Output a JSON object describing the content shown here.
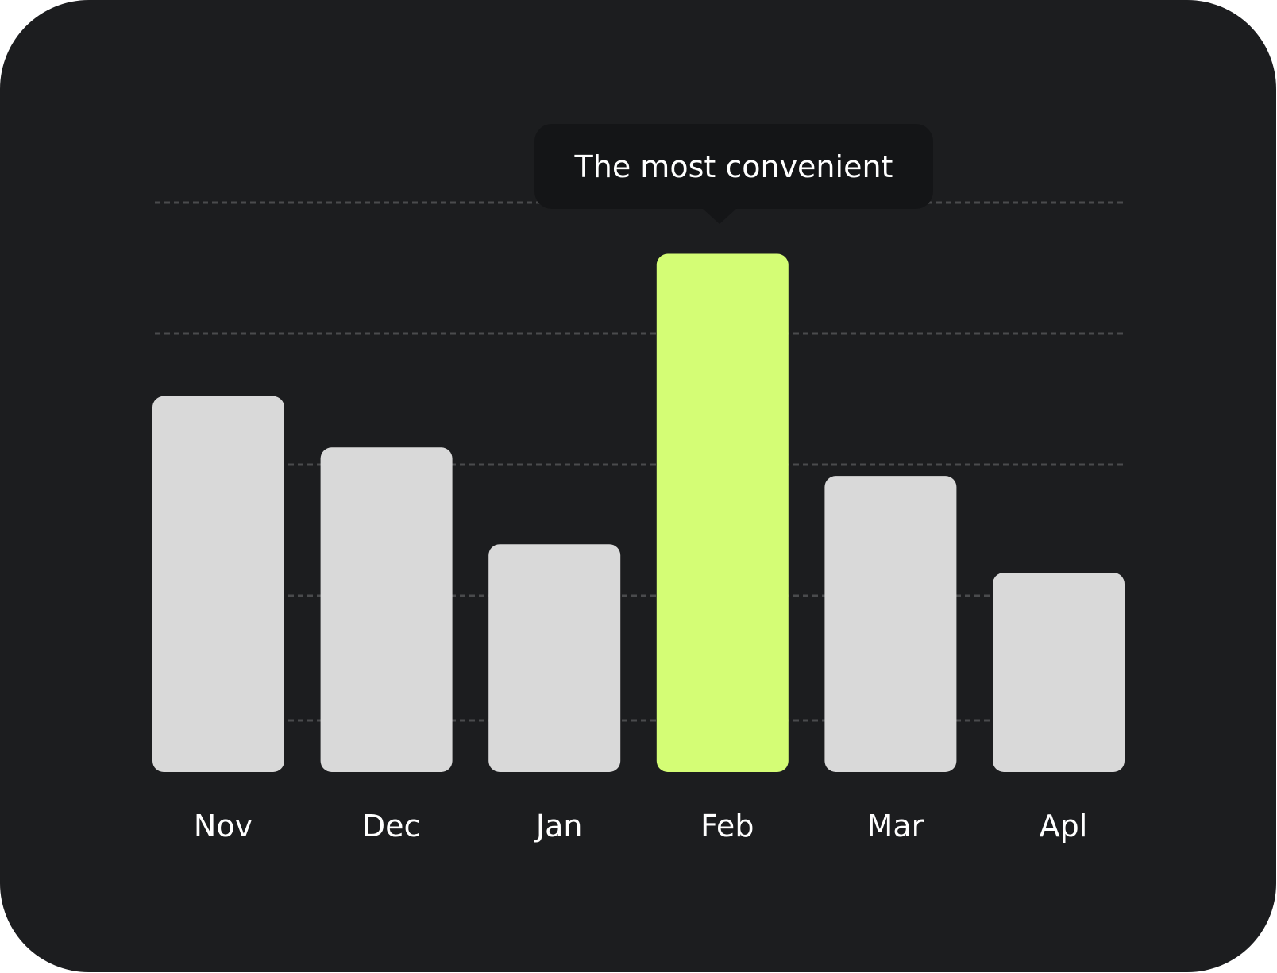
{
  "chart_data": {
    "type": "bar",
    "title": "",
    "xlabel": "",
    "ylabel": "",
    "categories": [
      "Nov",
      "Dec",
      "Jan",
      "Feb",
      "Mar",
      "Apl"
    ],
    "values": [
      0.66,
      0.57,
      0.4,
      0.91,
      0.52,
      0.35
    ],
    "value_scale": "relative (fraction of top gridline)",
    "ylim": [
      0,
      1
    ],
    "gridlines": [
      0.09,
      0.31,
      0.54,
      0.77,
      1.0
    ],
    "grid": true,
    "grid_style": "dotted",
    "highlight_index": 3,
    "annotation": {
      "text": "The most convenient",
      "target": "Feb"
    },
    "legend": "none"
  },
  "colors": {
    "background": "#1c1d1f",
    "bar": "#d9d9d9",
    "highlight_bar": "#d4fd75",
    "gridline": "#4a4b4d",
    "tooltip_bg": "#141517",
    "text": "#ffffff"
  }
}
